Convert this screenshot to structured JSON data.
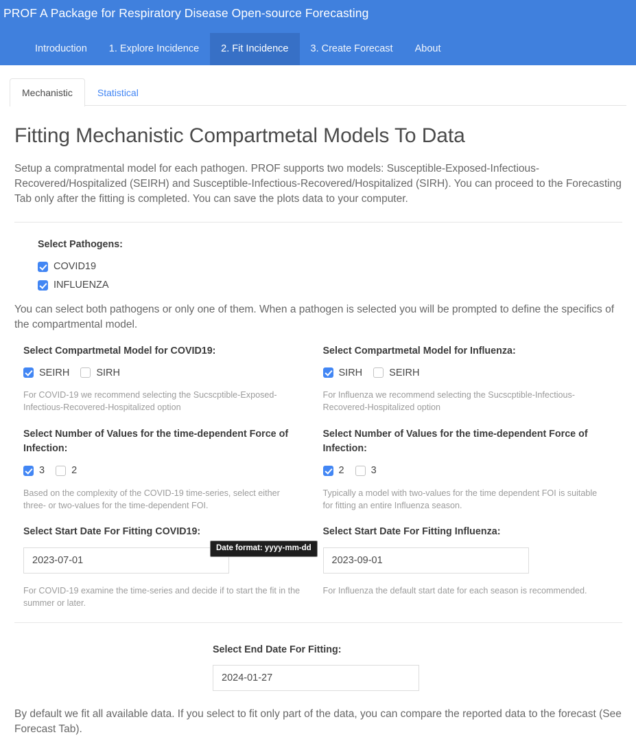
{
  "navbar": {
    "brand": "PROF A Package for Respiratory Disease Open-source Forecasting",
    "items": [
      {
        "label": "Introduction",
        "active": false
      },
      {
        "label": "1. Explore Incidence",
        "active": false
      },
      {
        "label": "2. Fit Incidence",
        "active": true
      },
      {
        "label": "3. Create Forecast",
        "active": false
      },
      {
        "label": "About",
        "active": false
      }
    ],
    "accent_color": "#4080dd",
    "active_color": "#3770c6"
  },
  "tabs": [
    {
      "label": "Mechanistic",
      "active": true
    },
    {
      "label": "Statistical",
      "active": false
    }
  ],
  "main": {
    "title": "Fitting Mechanistic Compartmetal Models To Data",
    "intro": "Setup a compratmental model for each pathogen. PROF supports two models: Susceptible-Exposed-Infectious-Recovered/Hospitalized (SEIRH) and Susceptible-Infectious-Recovered/Hospitalized (SIRH). You can proceed to the Forecasting Tab only after the fitting is completed. You can save the plots data to your computer.",
    "pathogens_label": "Select Pathogens:",
    "pathogens": [
      {
        "label": "COVID19",
        "checked": true
      },
      {
        "label": "INFLUENZA",
        "checked": true
      }
    ],
    "pathogens_explain": "You can select both pathogens or only one of them. When a pathogen is selected you will be prompted to define the specifics of the compartmental model.",
    "footnote": "By default we fit all available data. If you select to fit only part of the data, you can compare the reported data to the forecast (See Forecast Tab)."
  },
  "covid_column": {
    "model_label": "Select Compartmetal Model for COVID19:",
    "model_options": [
      {
        "label": "SEIRH",
        "checked": true
      },
      {
        "label": "SIRH",
        "checked": false
      }
    ],
    "model_help": "For COVID-19 we recommend selecting the Sucscptible-Exposed-Infectious-Recovered-Hospitalized option",
    "foi_label": "Select Number of Values for the time-dependent Force of Infection:",
    "foi_options": [
      {
        "label": "3",
        "checked": true
      },
      {
        "label": "2",
        "checked": false
      }
    ],
    "foi_help": "Based on the complexity of the COVID-19 time-series, select either three- or two-values for the time-dependent FOI.",
    "start_date_label": "Select Start Date For Fitting COVID19:",
    "start_date_value": "2023-07-01",
    "start_date_placeholder": "yyyy-mm-dd",
    "start_date_help": "For COVID-19 examine the time-series and decide if to start the fit in the summer or later."
  },
  "influenza_column": {
    "model_label": "Select Compartmetal Model for Influenza:",
    "model_options": [
      {
        "label": "SIRH",
        "checked": true
      },
      {
        "label": "SEIRH",
        "checked": false
      }
    ],
    "model_help": "For Influenza we recommend selecting the Sucscptible-Infectious-Recovered-Hospitalized option",
    "foi_label": "Select Number of Values for the time-dependent Force of Infection:",
    "foi_options": [
      {
        "label": "2",
        "checked": true
      },
      {
        "label": "3",
        "checked": false
      }
    ],
    "foi_help": "Typically a model with two-values for the time dependent FOI is suitable for fitting an entire Influenza season.",
    "start_date_label": "Select Start Date For Fitting Influenza:",
    "start_date_value": "2023-09-01",
    "start_date_placeholder": "yyyy-mm-dd",
    "start_date_help": "For Influenza the default start date for each season is recommended."
  },
  "end_date": {
    "label": "Select End Date For Fitting:",
    "value": "2024-01-27",
    "placeholder": "yyyy-mm-dd"
  },
  "tooltip": {
    "text": "Date format: yyyy-mm-dd"
  }
}
